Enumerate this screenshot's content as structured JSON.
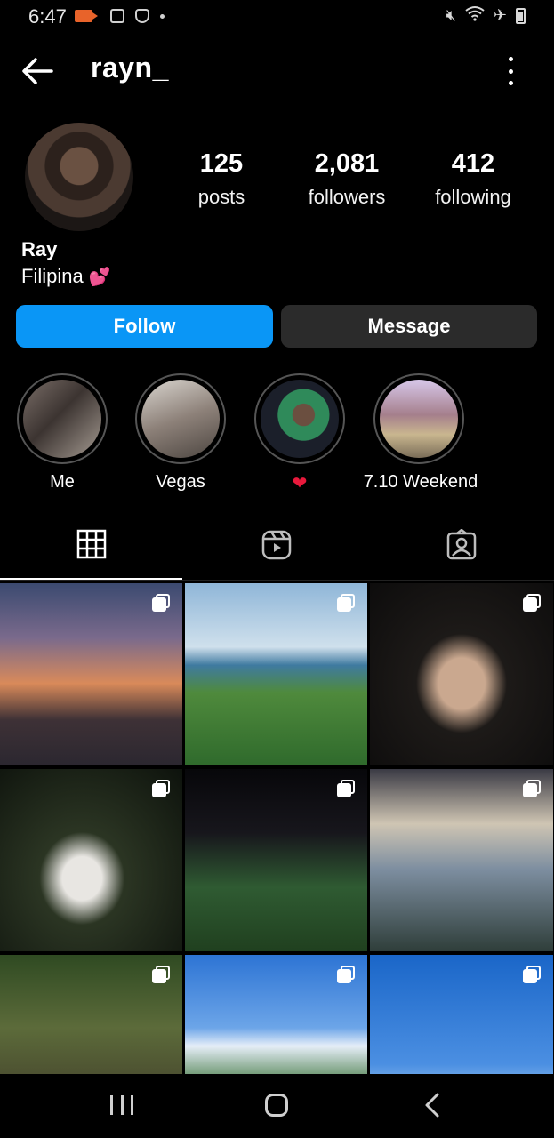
{
  "status_bar": {
    "time": "6:47"
  },
  "header": {
    "username": "rayn_"
  },
  "profile": {
    "stats": [
      {
        "value": "125",
        "label": "posts"
      },
      {
        "value": "2,081",
        "label": "followers"
      },
      {
        "value": "412",
        "label": "following"
      }
    ],
    "name": "Ray",
    "bio": "Filipina",
    "bio_emoji": "💕"
  },
  "actions": {
    "follow_label": "Follow",
    "message_label": "Message"
  },
  "highlights": [
    {
      "label": "Me"
    },
    {
      "label": "Vegas"
    },
    {
      "label": "❤"
    },
    {
      "label": "7.10 Weekend"
    }
  ],
  "tabs": [
    "grid-icon",
    "reels-icon",
    "tagged-icon"
  ],
  "colors": {
    "accent": "#0a96f6",
    "message_bg": "#2b2b2b",
    "background": "#000000"
  }
}
